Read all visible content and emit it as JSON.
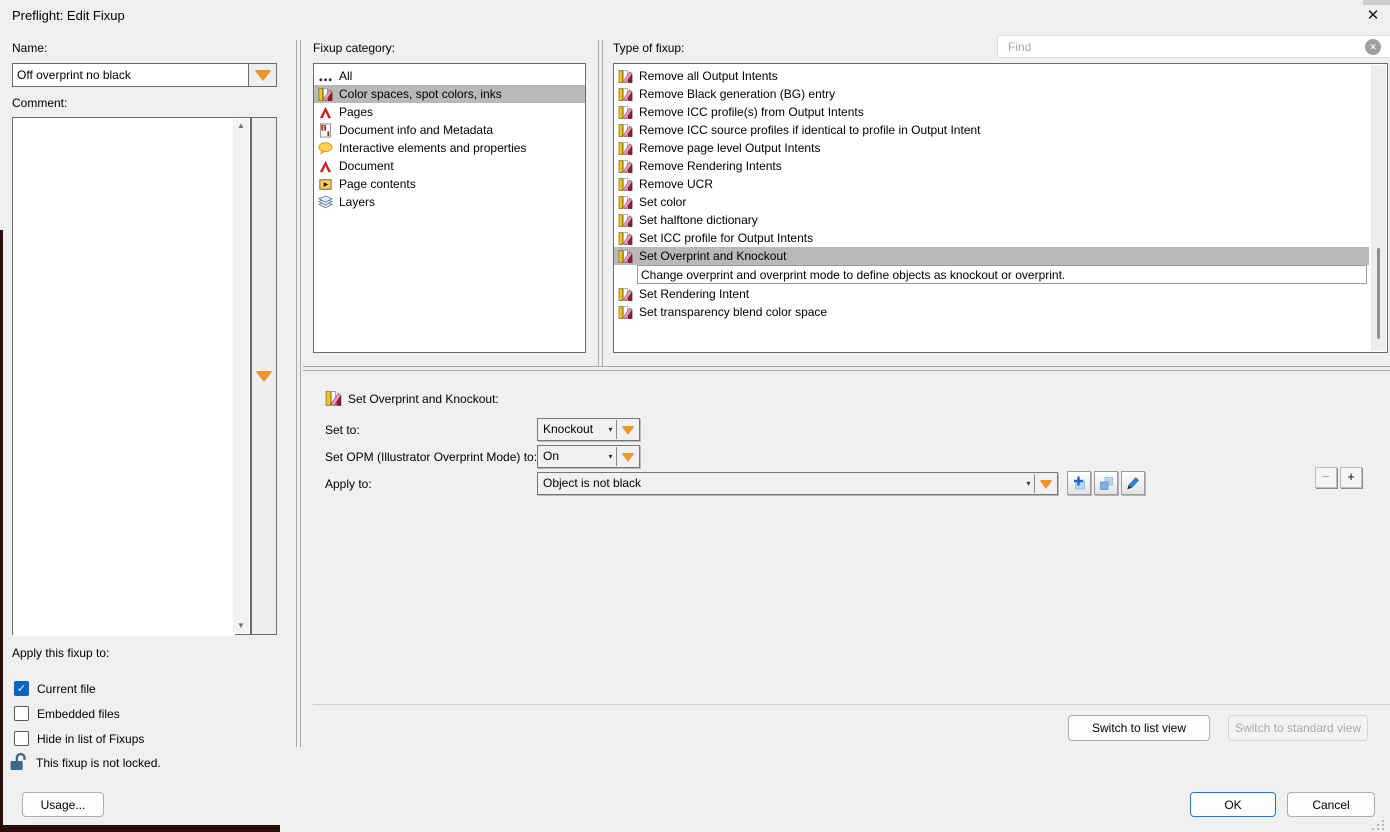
{
  "window": {
    "title": "Preflight: Edit Fixup",
    "close_glyph": "✕"
  },
  "left": {
    "name_label": "Name:",
    "name_value": "Off overprint no black",
    "comment_label": "Comment:",
    "comment_value": "",
    "apply_label": "Apply this fixup to:",
    "checkboxes": [
      {
        "label": "Current file",
        "checked": true
      },
      {
        "label": "Embedded files",
        "checked": false
      },
      {
        "label": "Hide in list of Fixups",
        "checked": false
      }
    ],
    "lock_text": "This fixup is not locked.",
    "usage_button": "Usage..."
  },
  "category_panel": {
    "label": "Fixup category:",
    "items": [
      {
        "icon": "all-icon",
        "label": "All"
      },
      {
        "icon": "color-icon",
        "label": "Color spaces, spot colors, inks",
        "selected": true
      },
      {
        "icon": "pdf-icon",
        "label": "Pages"
      },
      {
        "icon": "info-icon",
        "label": "Document info and Metadata"
      },
      {
        "icon": "comment-icon",
        "label": "Interactive elements and properties"
      },
      {
        "icon": "pdf-icon",
        "label": "Document"
      },
      {
        "icon": "page-contents-icon",
        "label": "Page contents"
      },
      {
        "icon": "layers-icon",
        "label": "Layers"
      }
    ]
  },
  "fixup_panel": {
    "label": "Type of fixup:",
    "find_placeholder": "Find",
    "find_clear_glyph": "✕",
    "items": [
      {
        "icon": "color-icon",
        "label": "Remove all Output Intents"
      },
      {
        "icon": "color-icon",
        "label": "Remove Black generation (BG) entry"
      },
      {
        "icon": "color-icon",
        "label": "Remove ICC profile(s) from Output Intents"
      },
      {
        "icon": "color-icon",
        "label": "Remove ICC source profiles if identical to profile in Output Intent"
      },
      {
        "icon": "color-icon",
        "label": "Remove page level Output Intents"
      },
      {
        "icon": "color-icon",
        "label": "Remove Rendering Intents"
      },
      {
        "icon": "color-icon",
        "label": "Remove UCR"
      },
      {
        "icon": "color-icon",
        "label": "Set color"
      },
      {
        "icon": "color-icon",
        "label": "Set halftone dictionary"
      },
      {
        "icon": "color-icon",
        "label": "Set ICC profile for Output Intents"
      },
      {
        "icon": "color-icon",
        "label": "Set Overprint and Knockout",
        "selected": true,
        "description": "Change overprint and overprint mode to define objects as knockout or overprint."
      },
      {
        "icon": "color-icon",
        "label": "Set Rendering Intent"
      },
      {
        "icon": "color-icon",
        "label": "Set transparency blend color space"
      }
    ]
  },
  "settings": {
    "header": "Set Overprint and Knockout:",
    "set_to_label": "Set to:",
    "set_to_value": "Knockout",
    "opm_label": "Set OPM (Illustrator Overprint Mode) to:",
    "opm_value": "On",
    "apply_to_label": "Apply to:",
    "apply_to_value": "Object is not black",
    "caret_glyph": "▾",
    "minus_label": "−",
    "plus_label": "+"
  },
  "footer": {
    "switch_list": "Switch to list view",
    "switch_standard": "Switch to standard view",
    "ok": "OK",
    "cancel": "Cancel"
  },
  "colors": {
    "accent_orange": "#F7941E",
    "selection_gray": "#B9B9B9",
    "checkbox_blue": "#0067C0",
    "ok_border": "#1E7AD4",
    "background_app": "#2A0E0B"
  }
}
